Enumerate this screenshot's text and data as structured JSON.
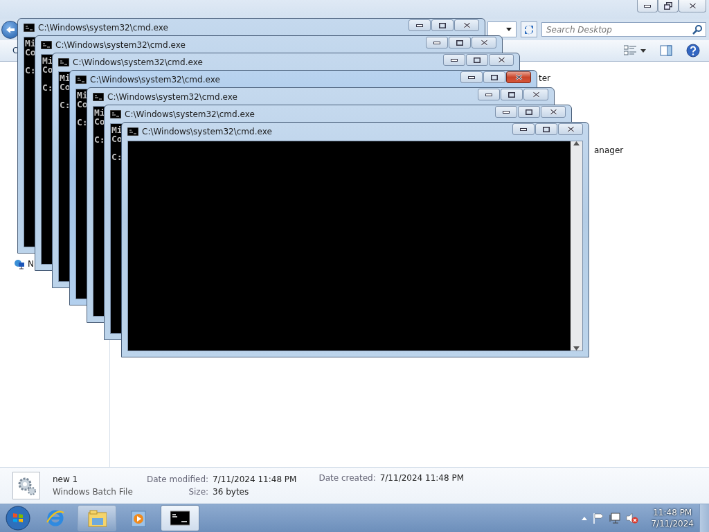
{
  "explorer": {
    "search": {
      "placeholder": "Search Desktop"
    },
    "toolbar_fragment": "C",
    "items": [
      {
        "label": "ter"
      },
      {
        "label": "anager"
      }
    ],
    "nav_items": [
      {
        "label": "N"
      }
    ],
    "details": {
      "name": "new 1",
      "type": "Windows Batch File",
      "modified_label": "Date modified:",
      "modified": "7/11/2024 11:48 PM",
      "size_label": "Size:",
      "size": "36 bytes",
      "created_label": "Date created:",
      "created": "7/11/2024 11:48 PM"
    }
  },
  "cmd_windows": [
    {
      "title": "C:\\Windows\\system32\\cmd.exe",
      "active": false,
      "console_lines": [
        "Mi",
        "Co",
        "C:"
      ]
    },
    {
      "title": "C:\\Windows\\system32\\cmd.exe",
      "active": false,
      "console_lines": [
        "Mi",
        "Co",
        "C:"
      ]
    },
    {
      "title": "C:\\Windows\\system32\\cmd.exe",
      "active": false,
      "console_lines": [
        "Mi",
        "Co",
        "C:"
      ]
    },
    {
      "title": "C:\\Windows\\system32\\cmd.exe",
      "active": true,
      "console_lines": [
        "Mi",
        "Co",
        "C:"
      ]
    },
    {
      "title": "C:\\Windows\\system32\\cmd.exe",
      "active": false,
      "console_lines": [
        "Mi",
        "Co",
        "C:"
      ]
    },
    {
      "title": "C:\\Windows\\system32\\cmd.exe",
      "active": false,
      "console_lines": [
        "Mi",
        "Co",
        "C:"
      ]
    },
    {
      "title": "C:\\Windows\\system32\\cmd.exe",
      "active": false
    }
  ],
  "taskbar": {
    "apps": [
      {
        "kind": "ie",
        "selected": false
      },
      {
        "kind": "explorer",
        "selected": false
      },
      {
        "kind": "media",
        "selected": false
      },
      {
        "kind": "cmd",
        "selected": true
      }
    ],
    "time": "11:48 PM",
    "date": "7/11/2024"
  }
}
